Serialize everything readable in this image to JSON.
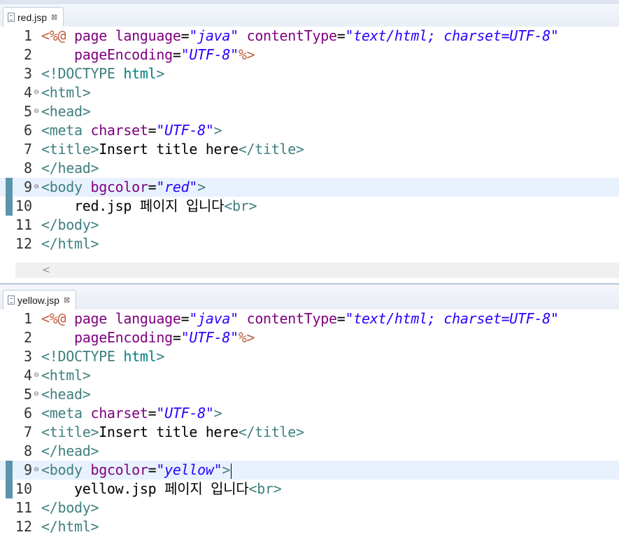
{
  "editors": [
    {
      "tab_label": "red.jsp",
      "close_glyph": "⊠",
      "lines": [
        {
          "no": "1",
          "fold": "",
          "tokens": [
            [
              "c-dir",
              "<%@ "
            ],
            [
              "c-attr",
              "page "
            ],
            [
              "c-attr",
              "language"
            ],
            [
              "c-txt",
              "="
            ],
            [
              "c-val",
              "\"java\""
            ],
            [
              "c-txt",
              " "
            ],
            [
              "c-attr",
              "contentType"
            ],
            [
              "c-txt",
              "="
            ],
            [
              "c-val",
              "\"text/html; charset=UTF-8\""
            ]
          ]
        },
        {
          "no": "2",
          "fold": "",
          "tokens": [
            [
              "c-txt",
              "    "
            ],
            [
              "c-attr",
              "pageEncoding"
            ],
            [
              "c-txt",
              "="
            ],
            [
              "c-val",
              "\"UTF-8\""
            ],
            [
              "c-dir",
              "%>"
            ]
          ]
        },
        {
          "no": "3",
          "fold": "",
          "tokens": [
            [
              "c-tag",
              "<!DOCTYPE "
            ],
            [
              "c-doc",
              "html"
            ],
            [
              "c-tag",
              ">"
            ]
          ]
        },
        {
          "no": "4",
          "fold": "⊖",
          "tokens": [
            [
              "c-tag",
              "<html>"
            ]
          ]
        },
        {
          "no": "5",
          "fold": "⊖",
          "tokens": [
            [
              "c-tag",
              "<head>"
            ]
          ]
        },
        {
          "no": "6",
          "fold": "",
          "tokens": [
            [
              "c-tag",
              "<meta "
            ],
            [
              "c-attr",
              "charset"
            ],
            [
              "c-txt",
              "="
            ],
            [
              "c-val",
              "\"UTF-8\""
            ],
            [
              "c-tag",
              ">"
            ]
          ]
        },
        {
          "no": "7",
          "fold": "",
          "tokens": [
            [
              "c-tag",
              "<title>"
            ],
            [
              "c-txt",
              "Insert title here"
            ],
            [
              "c-tag",
              "</title>"
            ]
          ]
        },
        {
          "no": "8",
          "fold": "",
          "tokens": [
            [
              "c-tag",
              "</head>"
            ]
          ]
        },
        {
          "no": "9",
          "fold": "⊖",
          "current": true,
          "marked": true,
          "tokens": [
            [
              "c-tag",
              "<body "
            ],
            [
              "c-attr",
              "bgcolor"
            ],
            [
              "c-txt",
              "="
            ],
            [
              "c-val",
              "\"red\""
            ],
            [
              "c-tag",
              ">"
            ]
          ]
        },
        {
          "no": "10",
          "fold": "",
          "marked": true,
          "tokens": [
            [
              "c-txt",
              "    red.jsp 페이지 입니다"
            ],
            [
              "c-tag",
              "<br>"
            ]
          ]
        },
        {
          "no": "11",
          "fold": "",
          "tokens": [
            [
              "c-tag",
              "</body>"
            ]
          ]
        },
        {
          "no": "12",
          "fold": "",
          "tokens": [
            [
              "c-tag",
              "</html>"
            ]
          ]
        }
      ]
    },
    {
      "tab_label": "yellow.jsp",
      "close_glyph": "⊠",
      "lines": [
        {
          "no": "1",
          "fold": "",
          "tokens": [
            [
              "c-dir",
              "<%@ "
            ],
            [
              "c-attr",
              "page "
            ],
            [
              "c-attr",
              "language"
            ],
            [
              "c-txt",
              "="
            ],
            [
              "c-val",
              "\"java\""
            ],
            [
              "c-txt",
              " "
            ],
            [
              "c-attr",
              "contentType"
            ],
            [
              "c-txt",
              "="
            ],
            [
              "c-val",
              "\"text/html; charset=UTF-8\""
            ]
          ]
        },
        {
          "no": "2",
          "fold": "",
          "tokens": [
            [
              "c-txt",
              "    "
            ],
            [
              "c-attr",
              "pageEncoding"
            ],
            [
              "c-txt",
              "="
            ],
            [
              "c-val",
              "\"UTF-8\""
            ],
            [
              "c-dir",
              "%>"
            ]
          ]
        },
        {
          "no": "3",
          "fold": "",
          "tokens": [
            [
              "c-tag",
              "<!DOCTYPE "
            ],
            [
              "c-doc",
              "html"
            ],
            [
              "c-tag",
              ">"
            ]
          ]
        },
        {
          "no": "4",
          "fold": "⊖",
          "tokens": [
            [
              "c-tag",
              "<html>"
            ]
          ]
        },
        {
          "no": "5",
          "fold": "⊖",
          "tokens": [
            [
              "c-tag",
              "<head>"
            ]
          ]
        },
        {
          "no": "6",
          "fold": "",
          "tokens": [
            [
              "c-tag",
              "<meta "
            ],
            [
              "c-attr",
              "charset"
            ],
            [
              "c-txt",
              "="
            ],
            [
              "c-val",
              "\"UTF-8\""
            ],
            [
              "c-tag",
              ">"
            ]
          ]
        },
        {
          "no": "7",
          "fold": "",
          "tokens": [
            [
              "c-tag",
              "<title>"
            ],
            [
              "c-txt",
              "Insert title here"
            ],
            [
              "c-tag",
              "</title>"
            ]
          ]
        },
        {
          "no": "8",
          "fold": "",
          "tokens": [
            [
              "c-tag",
              "</head>"
            ]
          ]
        },
        {
          "no": "9",
          "fold": "⊖",
          "current": true,
          "marked": true,
          "caret": true,
          "tokens": [
            [
              "c-tag",
              "<body "
            ],
            [
              "c-attr",
              "bgcolor"
            ],
            [
              "c-txt",
              "="
            ],
            [
              "c-val",
              "\"yellow\""
            ],
            [
              "c-tag",
              ">"
            ]
          ]
        },
        {
          "no": "10",
          "fold": "",
          "marked": true,
          "tokens": [
            [
              "c-txt",
              "    yellow.jsp 페이지 입니다"
            ],
            [
              "c-tag",
              "<br>"
            ]
          ]
        },
        {
          "no": "11",
          "fold": "",
          "tokens": [
            [
              "c-tag",
              "</body>"
            ]
          ]
        },
        {
          "no": "12",
          "fold": "",
          "tokens": [
            [
              "c-tag",
              "</html>"
            ]
          ]
        }
      ]
    }
  ],
  "scroll_left_glyph": "<",
  "colors": {
    "directive": "#bf5f3f",
    "attribute": "#7f007f",
    "value": "#2a00ff",
    "tag": "#3f7f7f",
    "current_line": "#e8f2fe",
    "ruler_marker": "#5b95ab"
  }
}
